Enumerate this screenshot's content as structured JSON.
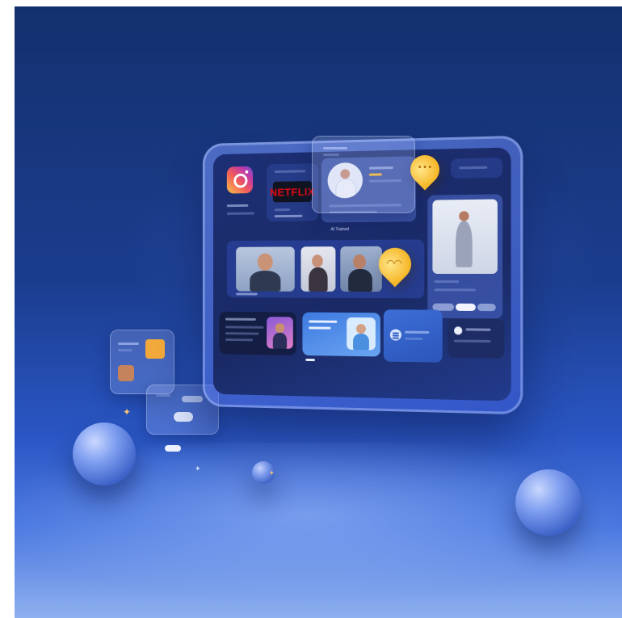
{
  "scene": {
    "colors": {
      "background_top": "#13306e",
      "background_bottom": "#4a78e0",
      "accent_yellow": "#f6b728",
      "netflix_red": "#e50914"
    }
  },
  "tablet": {
    "netflix_logo": "NETFLIX",
    "caption_ai": "AI Trained",
    "icons": [
      "instagram-icon",
      "netflix-logo",
      "lightbulb-pin-icon",
      "spotify-icon"
    ]
  },
  "widgets": {
    "profile_card": {},
    "video_row": {},
    "side_profile": {},
    "music_card": {}
  }
}
